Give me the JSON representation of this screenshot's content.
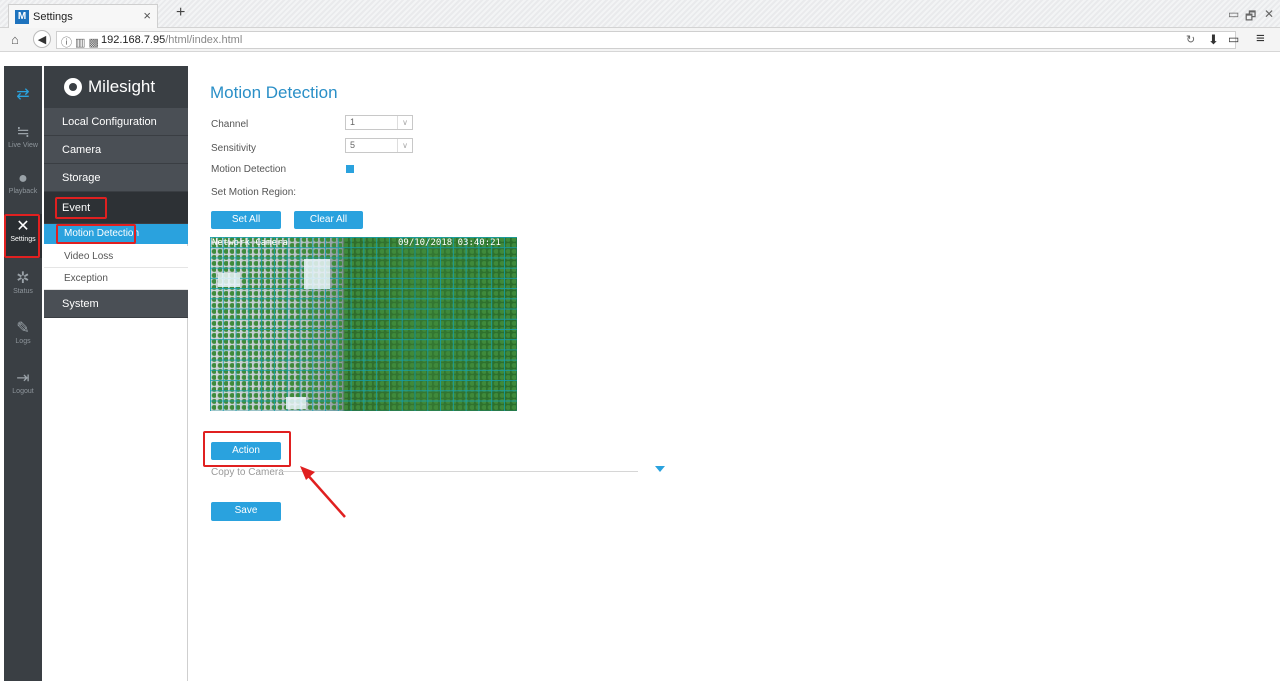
{
  "browser": {
    "tab_title": "Settings",
    "tab_close": "×",
    "new_tab": "+",
    "url_host": "192.168.7.95",
    "url_path": "/html/index.html",
    "window_controls": [
      "▭",
      "🗗",
      "✕"
    ]
  },
  "iconbar": {
    "items": [
      {
        "label": "",
        "icon": "swap-icon"
      },
      {
        "label": "Live View",
        "icon": "live-view-icon"
      },
      {
        "label": "Playback",
        "icon": "playback-icon"
      },
      {
        "label": "Settings",
        "icon": "settings-icon"
      },
      {
        "label": "Status",
        "icon": "status-icon"
      },
      {
        "label": "Logs",
        "icon": "logs-icon"
      },
      {
        "label": "Logout",
        "icon": "logout-icon"
      }
    ]
  },
  "menu": {
    "logo_text": "Milesight",
    "items": [
      "Local Configuration",
      "Camera",
      "Storage",
      "Event",
      "System"
    ],
    "event_sub": [
      "Motion Detection",
      "Video Loss",
      "Exception"
    ]
  },
  "content": {
    "title": "Motion Detection",
    "channel_label": "Channel",
    "channel_value": "1",
    "sensitivity_label": "Sensitivity",
    "sensitivity_value": "5",
    "motion_detection_label": "Motion Detection",
    "set_region_label": "Set Motion Region:",
    "set_all": "Set All",
    "clear_all": "Clear All",
    "camera_overlay_left": "Network Camera",
    "camera_overlay_right": "09/10/2018 03:40:21",
    "action": "Action",
    "copy_to_camera": "Copy to Camera",
    "save": "Save"
  },
  "colors": {
    "accent": "#2aa2de",
    "annotation_red": "#e02020",
    "sidebar_dark": "#3a3f44"
  }
}
